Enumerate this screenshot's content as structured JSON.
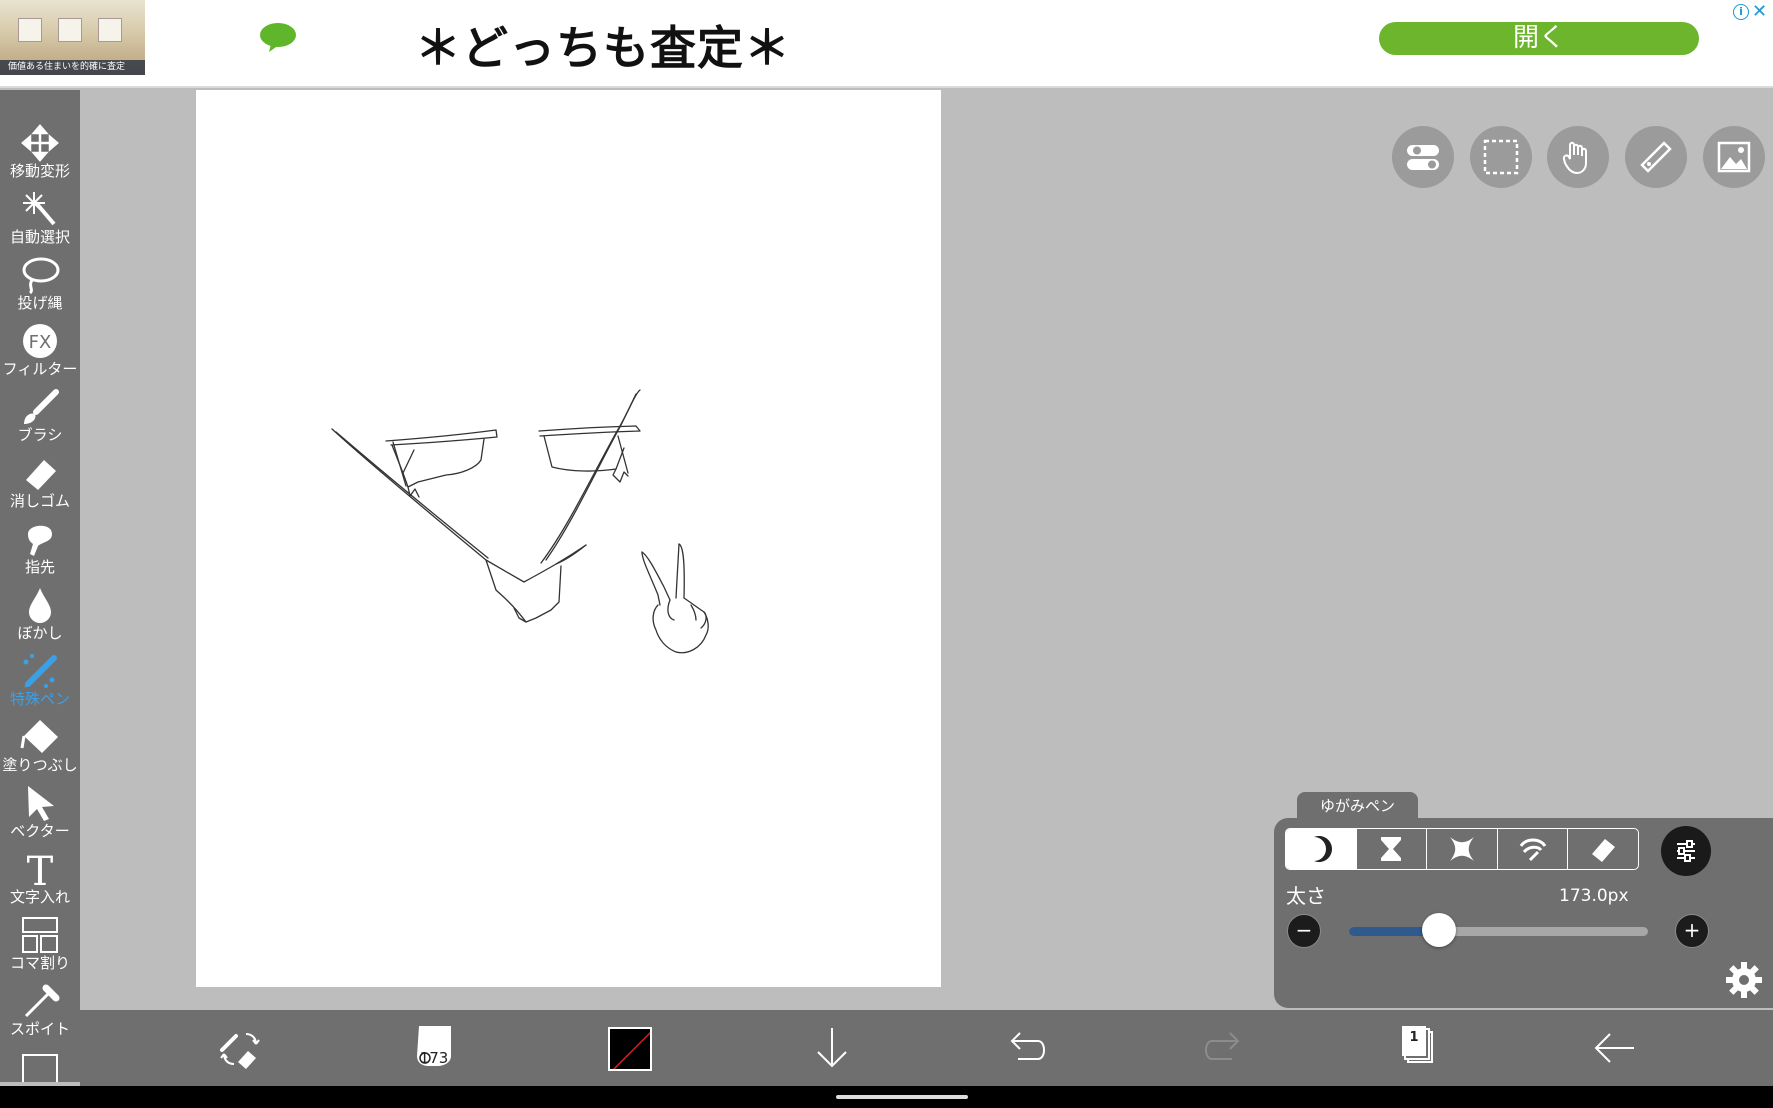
{
  "ad": {
    "thumb_caption": "価値ある住まいを的確に査定",
    "headline": "＊どっちも査定＊",
    "open_button": "開く",
    "info_icon": "info-icon",
    "close_icon": "close-icon"
  },
  "tools": [
    {
      "id": "move",
      "label": "移動変形",
      "icon": "move-icon",
      "active": false
    },
    {
      "id": "magic",
      "label": "自動選択",
      "icon": "magic-wand-icon",
      "active": false
    },
    {
      "id": "lasso",
      "label": "投げ縄",
      "icon": "lasso-icon",
      "active": false
    },
    {
      "id": "filter",
      "label": "フィルター",
      "icon": "fx-icon",
      "active": false
    },
    {
      "id": "brush",
      "label": "ブラシ",
      "icon": "brush-icon",
      "active": false
    },
    {
      "id": "eraser",
      "label": "消しゴム",
      "icon": "eraser-icon",
      "active": false
    },
    {
      "id": "finger",
      "label": "指先",
      "icon": "finger-icon",
      "active": false
    },
    {
      "id": "blur",
      "label": "ぼかし",
      "icon": "blur-drop-icon",
      "active": false
    },
    {
      "id": "special-pen",
      "label": "特殊ペン",
      "icon": "special-pen-icon",
      "active": true
    },
    {
      "id": "fill",
      "label": "塗りつぶし",
      "icon": "bucket-icon",
      "active": false
    },
    {
      "id": "vector",
      "label": "ベクター",
      "icon": "vector-arrow-icon",
      "active": false
    },
    {
      "id": "text",
      "label": "文字入れ",
      "icon": "text-icon",
      "active": false
    },
    {
      "id": "frame",
      "label": "コマ割り",
      "icon": "panel-frame-icon",
      "active": false
    },
    {
      "id": "eyedropper",
      "label": "スポイト",
      "icon": "eyedropper-icon",
      "active": false
    }
  ],
  "brush_panel": {
    "tab_label": "ゆがみペン",
    "size_label": "太さ",
    "size_value": "173.0px",
    "size_fraction": 0.3,
    "minus": "−",
    "plus": "+",
    "types": [
      "crescent-icon",
      "hourglass-icon",
      "pinch-icon",
      "swirl-icon",
      "eraser-icon"
    ],
    "selected_type": 0
  },
  "bottom": {
    "brush_size": "173",
    "current_color": "#000000",
    "layer_count": "1"
  },
  "colors": {
    "active_tool": "#3aa0e8",
    "ad_button": "#6cb52d",
    "slider_fill": "#2f5a8d"
  }
}
